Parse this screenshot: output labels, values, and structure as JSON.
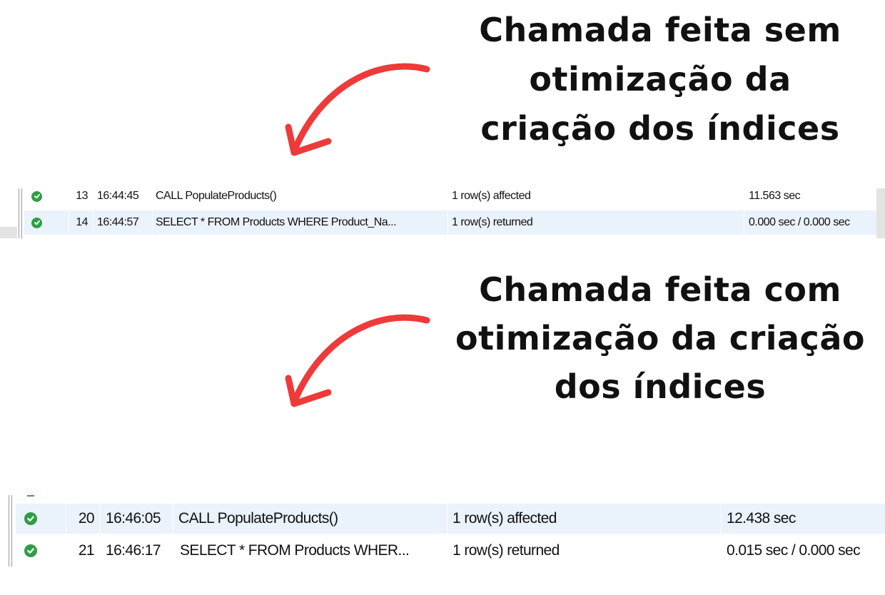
{
  "annotations": [
    {
      "lines": [
        "Chamada feita sem",
        "otimização da",
        "criação dos índices"
      ]
    },
    {
      "lines": [
        "Chamada feita com",
        "otimização da criação",
        "dos índices"
      ]
    }
  ],
  "arrow_color": "#ee3a3a",
  "status_icon": "success-check-icon",
  "status_color": "#2f9e44",
  "highlight_row_color": "#eaf2fb",
  "grids": [
    {
      "rows": [
        {
          "num": "13",
          "time": "16:44:45",
          "action": "CALL PopulateProducts()",
          "message": "1 row(s) affected",
          "duration": "11.563 sec"
        },
        {
          "num": "14",
          "time": "16:44:57",
          "action": "SELECT * FROM Products WHERE Product_Na...",
          "message": "1 row(s) returned",
          "duration": "0.000 sec / 0.000 sec"
        }
      ]
    },
    {
      "rows": [
        {
          "num": "20",
          "time": "16:46:05",
          "action": "CALL PopulateProducts()",
          "message": "1 row(s) affected",
          "duration": "12.438 sec"
        },
        {
          "num": "21",
          "time": "16:46:17",
          "action": "SELECT * FROM Products WHER...",
          "message": "1 row(s) returned",
          "duration": "0.015 sec / 0.000 sec"
        }
      ]
    }
  ]
}
